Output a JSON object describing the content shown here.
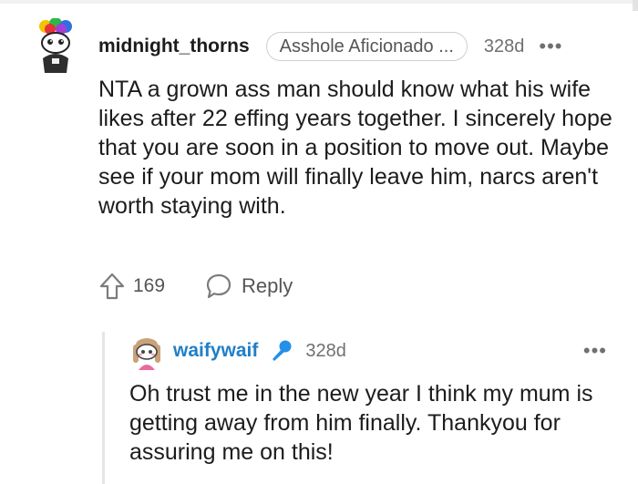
{
  "comment": {
    "username": "midnight_thorns",
    "flair": "Asshole Aficionado ...",
    "age": "328d",
    "more": "•••",
    "body": "NTA a grown ass man should know what his wife likes after 22 effing years together. I sincerely hope that you are soon in a position to move out. Maybe see if your mom will finally leave him, narcs aren't worth staying with.",
    "upvotes": "169",
    "reply_label": "Reply",
    "avatar_icon": "snoo-avatar-icon",
    "upvote_icon": "upvote-arrow-icon",
    "reply_icon": "speech-bubble-icon"
  },
  "reply": {
    "username": "waifywaif",
    "age": "328d",
    "more": "•••",
    "body": "Oh trust me in the new year I think my mum is getting away from him finally. Thankyou for assuring me on this!",
    "avatar_icon": "snoo-avatar-icon",
    "op_icon": "microphone-icon"
  },
  "colors": {
    "username_reply": "#1f7fc7",
    "mic_icon": "#2490e8",
    "text": "#1c1c1c",
    "muted": "#707070"
  }
}
